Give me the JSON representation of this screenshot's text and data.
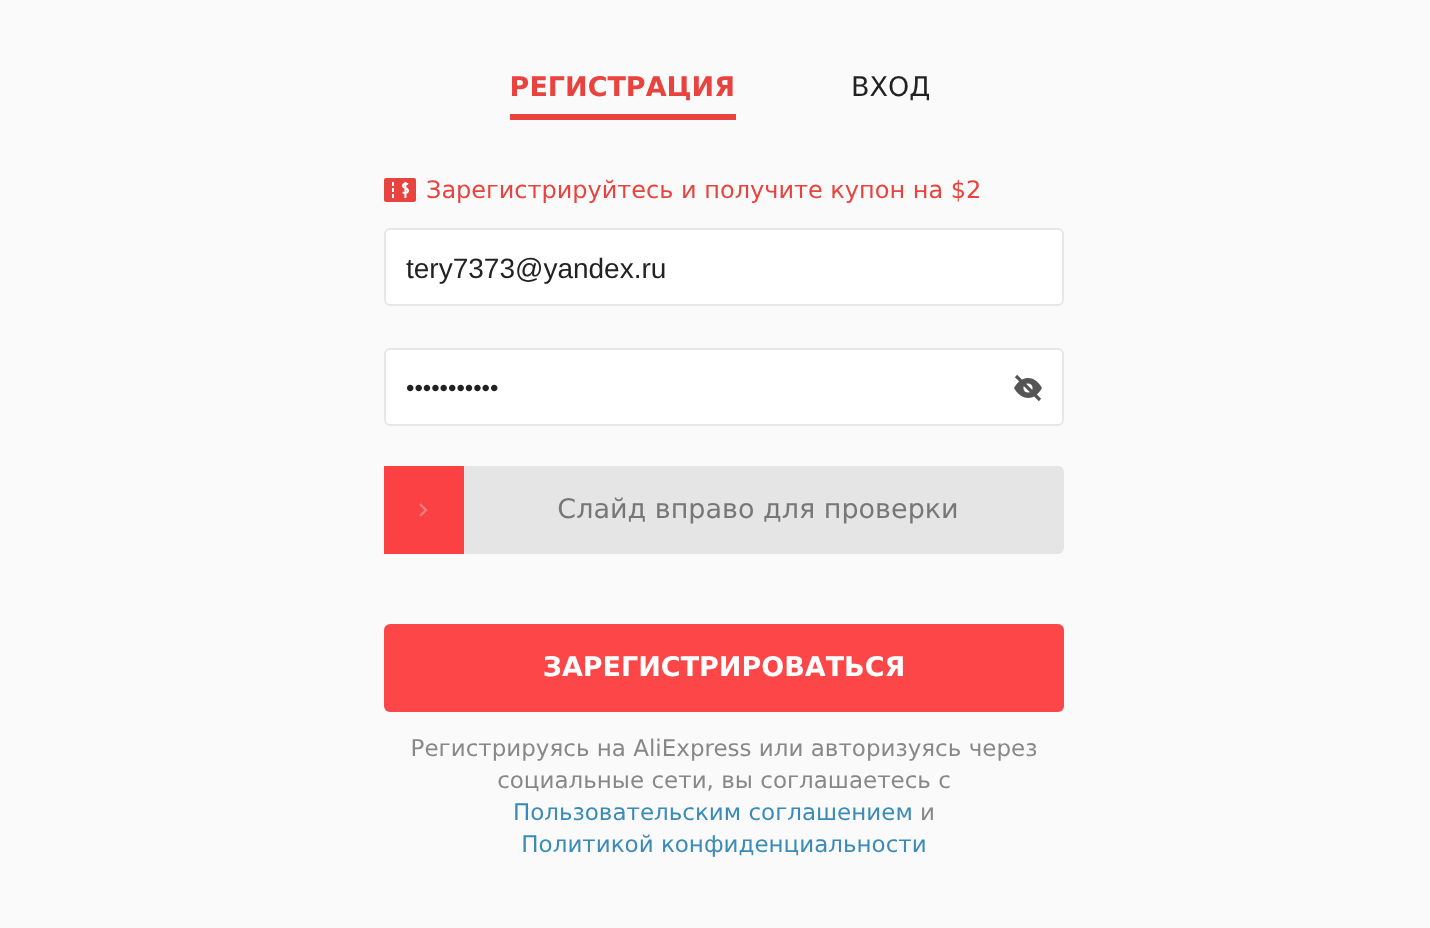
{
  "tabs": [
    {
      "label": "РЕГИСТРАЦИЯ",
      "selected": true
    },
    {
      "label": "ВХОД",
      "selected": false
    }
  ],
  "coupon": {
    "text": "Зарегистрируйтесь и получите купон на $2"
  },
  "email": {
    "value": "tery7373@yandex.ru"
  },
  "password": {
    "value": "•••••••••••",
    "visible": false
  },
  "slider": {
    "label": "Слайд вправо для проверки"
  },
  "submit": {
    "label": "ЗАРЕГИСТРИРОВАТЬСЯ"
  },
  "terms": {
    "text": "Регистрируясь на AliExpress или авторизуясь через социальные сети, вы соглашаетесь с",
    "link_1": "Пользовательским соглашением",
    "joiner": "и",
    "link_2": "Политикой конфиденциальности"
  }
}
